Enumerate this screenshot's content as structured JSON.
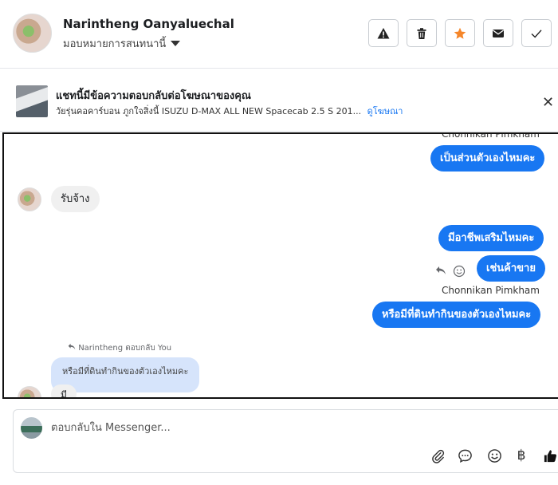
{
  "header": {
    "contact_name": "Narintheng Oanyaluechal",
    "assign_label": "มอบหมายการสนทนานี้",
    "buttons": [
      {
        "name": "report-button",
        "icon": "warning-icon"
      },
      {
        "name": "delete-button",
        "icon": "trash-icon"
      },
      {
        "name": "star-button",
        "icon": "star-icon"
      },
      {
        "name": "mark-unread-button",
        "icon": "envelope-icon"
      },
      {
        "name": "mark-done-button",
        "icon": "check-icon"
      }
    ]
  },
  "ad_banner": {
    "title": "แชทนี้มีข้อความตอบกลับต่อโฆษณาของคุณ",
    "subtitle": "วัยรุ่นคอคาร์บอน ภูกใจสิ่งนี้ ISUZU D-MAX ALL NEW Spacecab 2.5 S 201...",
    "link": "ดูโฆษณา",
    "close_label": "✕"
  },
  "thread": {
    "top_sender": "Chonnikan Pimkham",
    "messages": [
      {
        "text": "เป็นส่วนตัวเองไหมคะ"
      },
      {
        "text": "รับจ้าง"
      },
      {
        "text": "มีอาชีพเสริมไหมคะ"
      },
      {
        "text": "เช่นค้าขาย"
      },
      {
        "text": "หรือมีที่ดินทำกินของตัวเองไหมคะ"
      }
    ],
    "sender_repeat": "Chonnikan Pimkham",
    "reply_note": "Narintheng ตอบกลับ You",
    "quoted_text": "หรือมีที่ดินทำกินของตัวเองไหมคะ",
    "partial_text": "มี"
  },
  "composer": {
    "placeholder": "ตอบกลับใน Messenger...",
    "baht_symbol": "฿"
  },
  "colors": {
    "accent": "#1877f2",
    "star": "#f5862a",
    "quoted_bg": "#d6e4fb"
  }
}
